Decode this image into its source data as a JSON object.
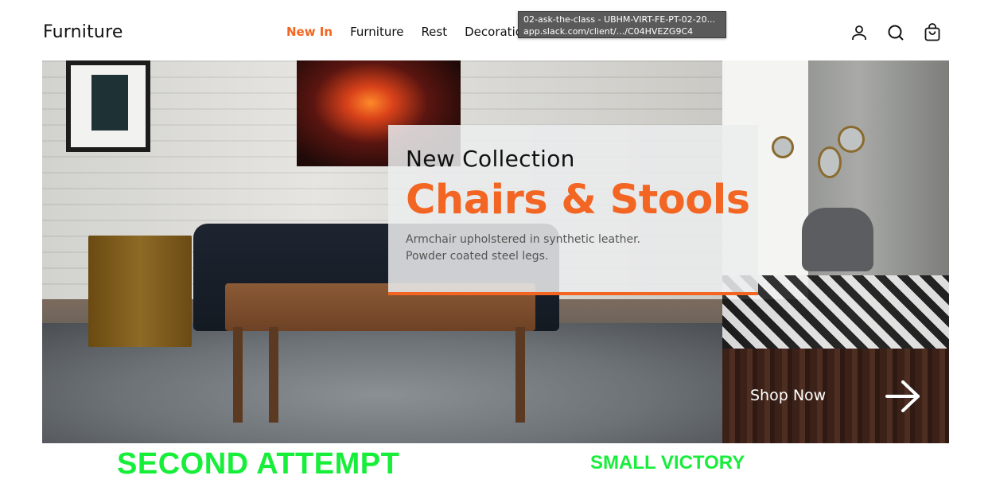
{
  "header": {
    "logo": "Furniture",
    "nav": [
      {
        "label": "New In",
        "active": true
      },
      {
        "label": "Furniture",
        "active": false
      },
      {
        "label": "Rest",
        "active": false
      },
      {
        "label": "Decoration",
        "active": false
      }
    ],
    "icons": [
      "user-icon",
      "search-icon",
      "shopping-bag-icon"
    ]
  },
  "tooltip": {
    "line1": "02-ask-the-class - UBHM-VIRT-FE-PT-02-20...",
    "line2": "app.slack.com/client/.../C04HVEZG9C4"
  },
  "hero": {
    "kicker": "New Collection",
    "title": "Chairs & Stools",
    "description_line1": "Armchair upholstered in synthetic leather.",
    "description_line2": "Powder coated steel legs."
  },
  "shop_now": {
    "label": "Shop Now"
  },
  "captions": {
    "left": "SECOND ATTEMPT",
    "right": "SMALL VICTORY"
  },
  "colors": {
    "accent": "#f26522",
    "caption_green": "#17ee3a",
    "text": "#111111"
  }
}
